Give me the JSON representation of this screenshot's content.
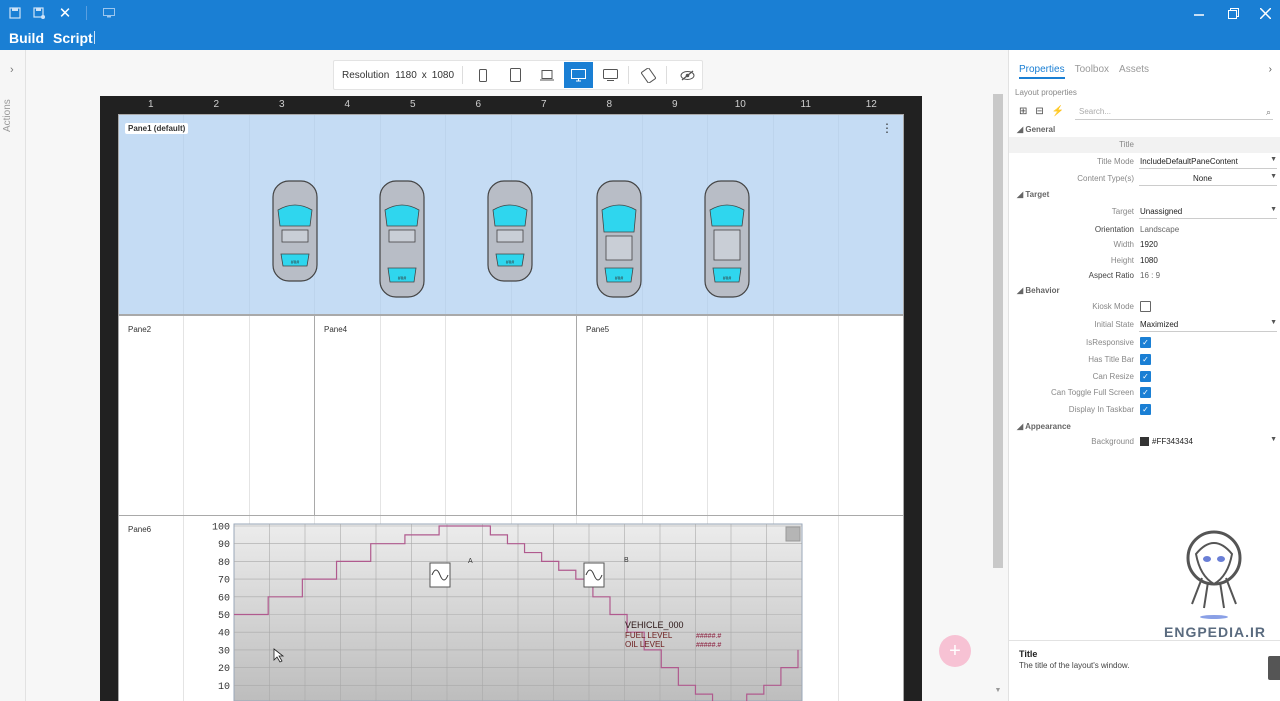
{
  "titlebar": {
    "menu": [
      "Build",
      "Script"
    ],
    "close_glyph": "✕",
    "icons": [
      "save-icon",
      "save-as-icon",
      "close-icon",
      "preview-icon",
      "minimize-icon",
      "restore-icon",
      "window-close-icon"
    ]
  },
  "sidebar": {
    "actions_label": "Actions"
  },
  "resolution": {
    "label": "Resolution",
    "width": "1180",
    "sep": "x",
    "height": "1080"
  },
  "ruler": [
    "1",
    "2",
    "3",
    "4",
    "5",
    "6",
    "7",
    "8",
    "9",
    "10",
    "11",
    "12"
  ],
  "panes": {
    "pane1": "Pane1 (default)",
    "pane2": "Pane2",
    "pane4": "Pane4",
    "pane5": "Pane5",
    "pane6": "Pane6"
  },
  "car_badge": "###",
  "chart": {
    "yticks": [
      "100",
      "90",
      "80",
      "70",
      "60",
      "50",
      "40",
      "30",
      "20",
      "10"
    ],
    "marker_a": "A",
    "marker_b": "B",
    "vehicle": "VEHICLE_000",
    "fuel_label": "FUEL LEVEL",
    "oil_label": "OIL LEVEL",
    "fuel_value": "#####.#",
    "oil_value": "#####.#"
  },
  "chart_data": {
    "type": "line",
    "x": [
      1,
      2,
      3,
      4,
      5,
      6,
      7,
      8,
      9,
      10,
      11,
      12,
      13,
      14,
      15,
      16,
      17,
      18,
      19,
      20,
      21,
      22,
      23,
      24,
      25,
      26,
      27,
      28,
      29,
      30,
      31,
      32,
      33,
      34
    ],
    "series": [
      {
        "values": [
          50,
          50,
          60,
          60,
          70,
          70,
          80,
          80,
          90,
          90,
          95,
          95,
          100,
          100,
          100,
          95,
          90,
          85,
          80,
          75,
          70,
          60,
          50,
          40,
          30,
          20,
          10,
          5,
          0,
          0,
          5,
          10,
          20,
          30
        ]
      }
    ],
    "ylim": [
      0,
      100
    ],
    "grid": true
  },
  "props": {
    "tabs": [
      "Properties",
      "Toolbox",
      "Assets"
    ],
    "subtitle": "Layout properties",
    "search_placeholder": "Search...",
    "sections": {
      "general": "General",
      "target": "Target",
      "behavior": "Behavior",
      "appearance": "Appearance"
    },
    "rows": {
      "title_label": "Title",
      "title_mode_label": "Title Mode",
      "title_mode_value": "IncludeDefaultPaneContent",
      "content_type_label": "Content Type(s)",
      "content_type_value": "None",
      "target_label": "Target",
      "target_value": "Unassigned",
      "orientation_label": "Orientation",
      "orientation_value": "Landscape",
      "width_label": "Width",
      "width_value": "1920",
      "height_label": "Height",
      "height_value": "1080",
      "aspect_label": "Aspect Ratio",
      "aspect_value": "16 : 9",
      "kiosk_label": "Kiosk Mode",
      "initial_state_label": "Initial State",
      "initial_state_value": "Maximized",
      "responsive_label": "IsResponsive",
      "titlebar_label": "Has Title Bar",
      "resize_label": "Can Resize",
      "fullscreen_label": "Can Toggle Full Screen",
      "taskbar_label": "Display In Taskbar",
      "background_label": "Background",
      "background_value": "#FF343434"
    },
    "help": {
      "title": "Title",
      "desc": "The title of the layout's window."
    }
  },
  "watermark": "ENGPEDIA.IR",
  "colors": {
    "accent": "#1a7fd4",
    "pane_bg": "#adcdf0",
    "line": "#b05a8e",
    "car_glass": "#2fd6ee"
  }
}
